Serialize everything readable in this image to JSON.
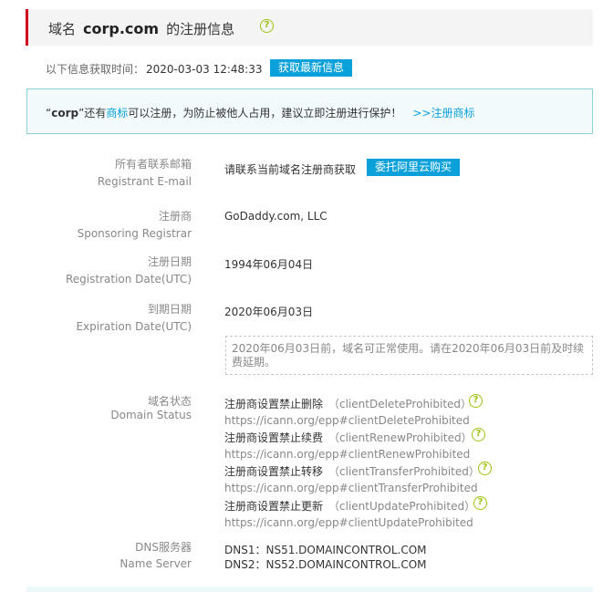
{
  "header": {
    "prefix": "域名",
    "domain": "corp.com",
    "suffix": "的注册信息",
    "help_icon": "question-circle-icon"
  },
  "fetch": {
    "label": "以下信息获取时间：",
    "time": "2020-03-03 12:48:33",
    "button": "获取最新信息"
  },
  "notice": {
    "quote_open": "“",
    "keyword": "corp",
    "quote_close": "”",
    "text_before_link": "还有",
    "link": "商标",
    "text_after_link": "可以注册，为防止被他人占用，建议立即注册进行保护！",
    "action_link": ">>注册商标"
  },
  "fields": {
    "email": {
      "label_zh": "所有者联系邮箱",
      "label_en": "Registrant E-mail",
      "value": "请联系当前域名注册商获取",
      "button": "委托阿里云购买"
    },
    "registrar": {
      "label_zh": "注册商",
      "label_en": "Sponsoring Registrar",
      "value": "GoDaddy.com, LLC"
    },
    "registration": {
      "label_zh": "注册日期",
      "label_en": "Registration Date(UTC)",
      "value": "1994年06月04日"
    },
    "expiration": {
      "label_zh": "到期日期",
      "label_en": "Expiration Date(UTC)",
      "value": "2020年06月03日",
      "note": "2020年06月03日前，域名可正常使用。请在2020年06月03日前及时续费延期。"
    },
    "status": {
      "label_zh": "域名状态",
      "label_en": "Domain Status",
      "items": [
        {
          "zh": "注册商设置禁止删除",
          "code": "（clientDeleteProhibited）",
          "url": "https://icann.org/epp#clientDeleteProhibited"
        },
        {
          "zh": "注册商设置禁止续费",
          "code": "（clientRenewProhibited）",
          "url": "https://icann.org/epp#clientRenewProhibited"
        },
        {
          "zh": "注册商设置禁止转移",
          "code": "（clientTransferProhibited）",
          "url": "https://icann.org/epp#clientTransferProhibited"
        },
        {
          "zh": "注册商设置禁止更新",
          "code": "（clientUpdateProhibited）",
          "url": "https://icann.org/epp#clientUpdateProhibited"
        }
      ]
    },
    "dns": {
      "label_zh": "DNS服务器",
      "label_en": "Name Server",
      "values": [
        "DNS1：NS51.DOMAINCONTROL.COM",
        "DNS2：NS52.DOMAINCONTROL.COM"
      ]
    }
  },
  "colors": {
    "accent_red": "#d0021b",
    "button_blue": "#0aa1db",
    "help_green": "#9bc10e",
    "notice_border": "#8fd2dd"
  }
}
